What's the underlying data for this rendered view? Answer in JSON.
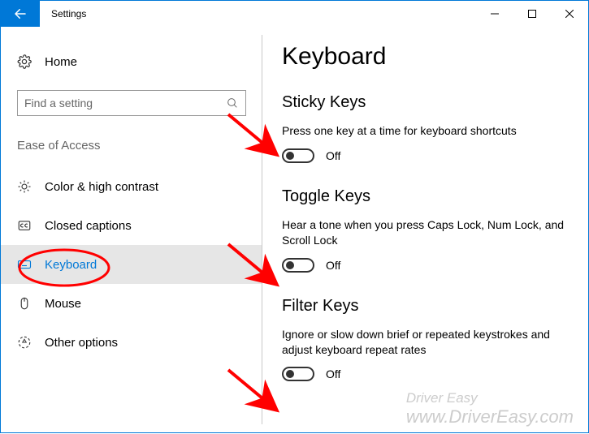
{
  "window": {
    "title": "Settings"
  },
  "sidebar": {
    "home": "Home",
    "search_placeholder": "Find a setting",
    "group": "Ease of Access",
    "items": [
      {
        "label": "Color & high contrast"
      },
      {
        "label": "Closed captions"
      },
      {
        "label": "Keyboard"
      },
      {
        "label": "Mouse"
      },
      {
        "label": "Other options"
      }
    ]
  },
  "page": {
    "title": "Keyboard",
    "sections": {
      "sticky": {
        "title": "Sticky Keys",
        "desc": "Press one key at a time for keyboard shortcuts",
        "state": "Off"
      },
      "toggle": {
        "title": "Toggle Keys",
        "desc": "Hear a tone when you press Caps Lock, Num Lock, and Scroll Lock",
        "state": "Off"
      },
      "filter": {
        "title": "Filter Keys",
        "desc": "Ignore or slow down brief or repeated keystrokes and adjust keyboard repeat rates",
        "state": "Off"
      }
    }
  },
  "watermark": {
    "line1": "Driver Easy",
    "line2": "www.DriverEasy.com"
  }
}
